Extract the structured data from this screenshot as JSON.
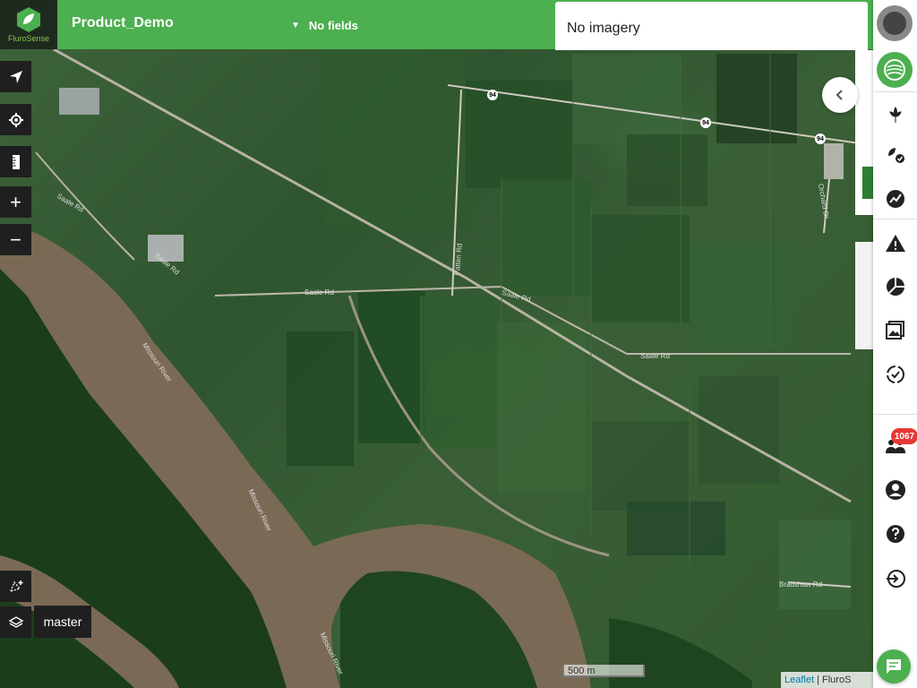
{
  "app": {
    "logo_text": "FluroSense",
    "brand_color": "#4caf50",
    "accent_dark": "#1f1f1f"
  },
  "header": {
    "project_name": "Product_Demo",
    "fields_dropdown": "No fields"
  },
  "imagery_panel": {
    "text": "No imagery"
  },
  "map": {
    "labels": {
      "saale_rd_1": "Saale Rd",
      "saale_rd_2": "Saale Rd",
      "saale_rd_3": "Saale Rd",
      "saale_rd_4": "Saale Rd",
      "saale_rd_5": "Saale Rd",
      "bradshaw_rd": "Bradshaw Rd",
      "patten_rd": "Patten Rd",
      "orchard_dr": "Orchard Dr",
      "missouri_river_1": "Missouri River",
      "missouri_river_2": "Missouri River",
      "missouri_river_3": "Missouri River",
      "route_1": "94",
      "route_2": "94",
      "route_3": "94"
    },
    "scale_text": "500 m",
    "attribution_link": "Leaflet",
    "attribution_sep": " | ",
    "attribution_text": "FluroS"
  },
  "map_controls": {
    "zoom_in": "+",
    "zoom_out": "−",
    "branch_label": "master"
  },
  "right_rail": {
    "notifications_count": "1067",
    "icons": [
      "avatar-icon",
      "farm-icon",
      "crop-icon",
      "crop-performance-icon",
      "analytics-icon",
      "alert-icon",
      "zoning-icon",
      "imagery-icon",
      "compare-icon",
      "team-icon",
      "account-icon",
      "help-icon",
      "logout-icon",
      "chat-icon"
    ]
  }
}
